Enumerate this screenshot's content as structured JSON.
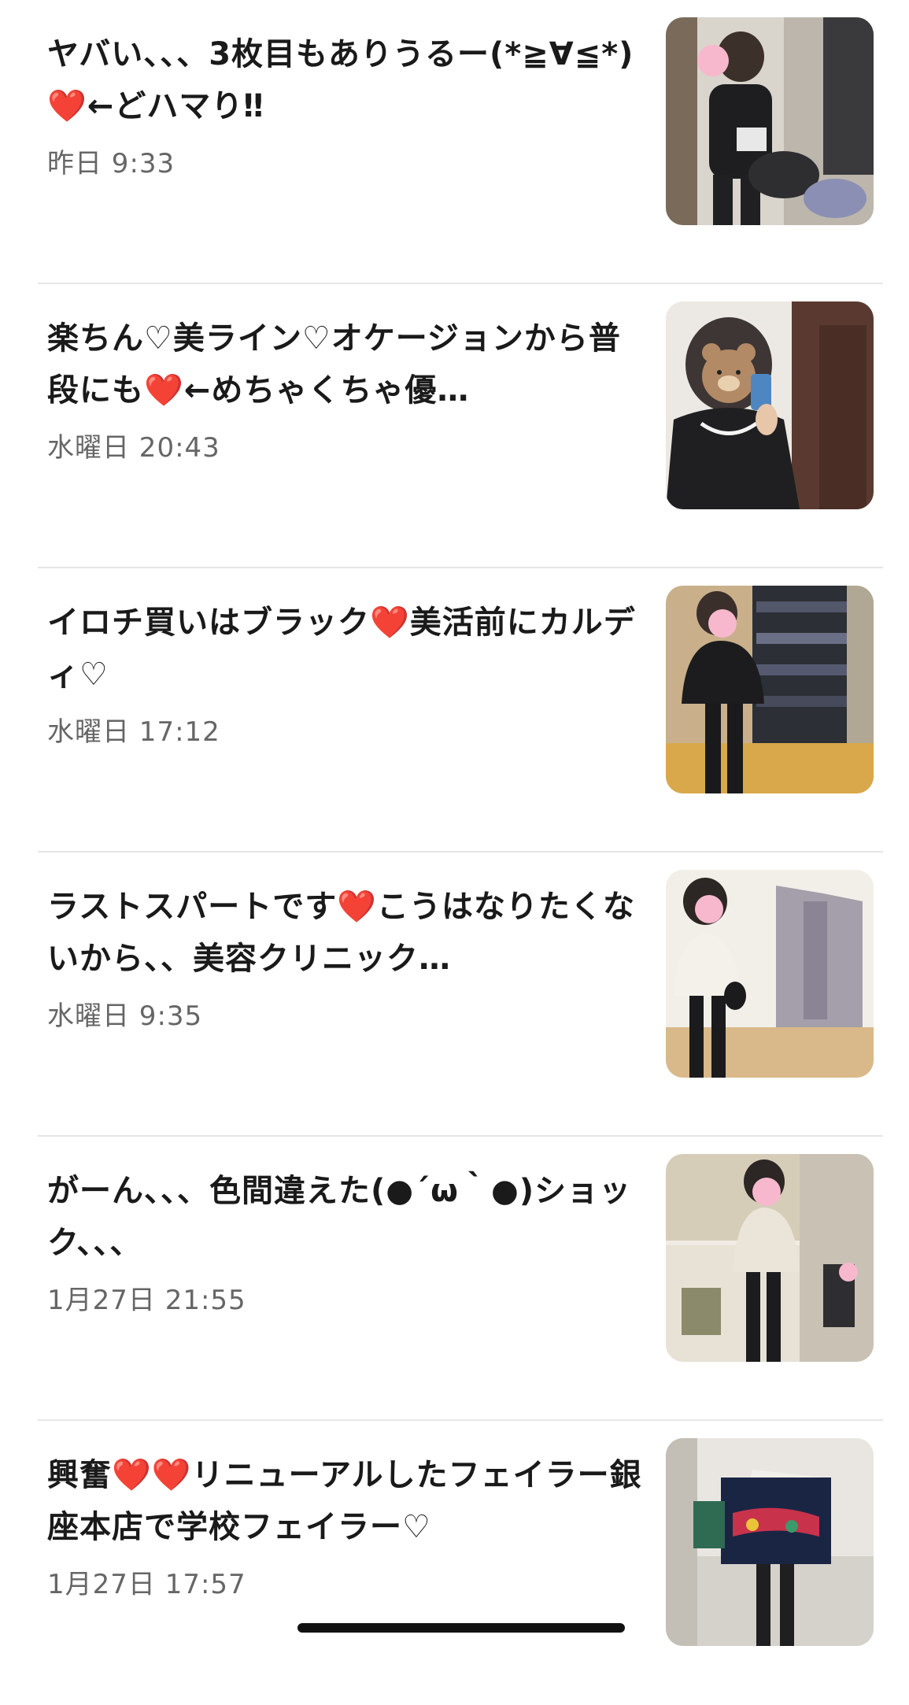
{
  "posts": [
    {
      "title": "ヤバい、、、3枚目もありうるー(*≧∀≦*)❤️←どハマり‼︎",
      "time": "昨日 9:33",
      "thumb_icon": "outfit-photo-thumbnail"
    },
    {
      "title": "楽ちん♡美ライン♡オケージョンから普段にも❤️←めちゃくちゃ優…",
      "time": "水曜日 20:43",
      "thumb_icon": "outfit-photo-thumbnail"
    },
    {
      "title": "イロチ買いはブラック❤️美活前にカルディ♡",
      "time": "水曜日 17:12",
      "thumb_icon": "outfit-photo-thumbnail"
    },
    {
      "title": "ラストスパートです❤️こうはなりたくないから、、美容クリニック…",
      "time": "水曜日 9:35",
      "thumb_icon": "outfit-photo-thumbnail"
    },
    {
      "title": "がーん、、、色間違えた(●´ω｀●)ショック、、、",
      "time": "1月27日 21:55",
      "thumb_icon": "outfit-photo-thumbnail"
    },
    {
      "title": "興奮❤️❤️リニューアルしたフェイラー銀座本店で学校フェイラー♡",
      "time": "1月27日 17:57",
      "thumb_icon": "outfit-photo-thumbnail"
    }
  ],
  "colors": {
    "title": "#1a1a1a",
    "meta": "#666666",
    "divider": "#e6e6e6",
    "heart": "#e0161b"
  }
}
